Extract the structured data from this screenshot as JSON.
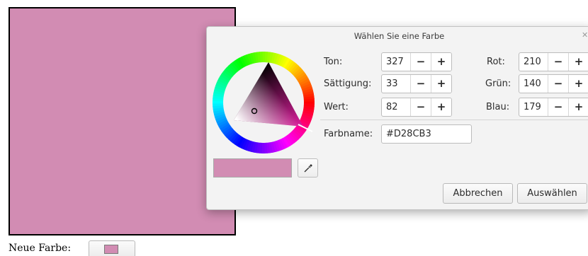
{
  "colors": {
    "current": "#D28CB3"
  },
  "footer": {
    "label": "Neue Farbe:"
  },
  "dialog": {
    "title": "Wählen Sie eine Farbe",
    "close_icon": "close-icon",
    "hsv": {
      "hue_label": "Ton:",
      "hue": "327",
      "saturation_label": "Sättigung:",
      "saturation": "33",
      "value_label": "Wert:",
      "value": "82"
    },
    "rgb": {
      "red_label": "Rot:",
      "red": "210",
      "green_label": "Grün:",
      "green": "140",
      "blue_label": "Blau:",
      "blue": "179"
    },
    "spin": {
      "minus": "−",
      "plus": "+"
    },
    "hex_label": "Farbname:",
    "hex_value": "#D28CB3",
    "picker_icon": "eyedropper-icon",
    "cancel_label": "Abbrechen",
    "select_label": "Auswählen"
  }
}
